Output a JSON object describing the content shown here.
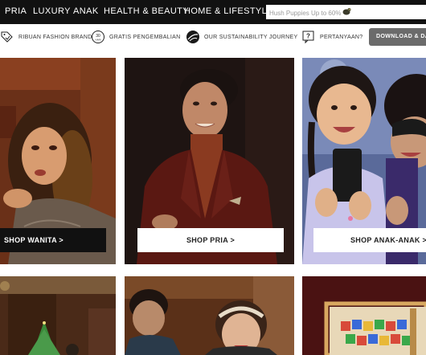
{
  "topnav": {
    "items": [
      "PRIA",
      "LUXURY",
      "ANAK",
      "HEALTH & BEAUTY",
      "HOME & LIFESTYLE"
    ],
    "search_placeholder": "Hush Puppies Up to 60%"
  },
  "benefits": [
    {
      "label": "RIBUAN FASHION BRAND",
      "icon": "tag-check-icon"
    },
    {
      "label": "GRATIS PENGEMBALIAN",
      "icon": "30-days-return-icon"
    },
    {
      "label": "OUR SUSTAINABILITY JOURNEY",
      "icon": "globe-leaf-icon"
    },
    {
      "label": "PERTANYAAN?",
      "icon": "question-chat-icon"
    }
  ],
  "download_label": "DOWNLOAD & DAPATKAN",
  "tiles": {
    "wanita": {
      "cta": "SHOP WANITA >"
    },
    "pria": {
      "cta": "SHOP PRIA >"
    },
    "anak": {
      "cta": "SHOP ANAK-ANAK >"
    }
  },
  "colors": {
    "nav_bg": "#111111",
    "button_bg": "#6b6b6b",
    "cta_dark": "#111111",
    "cta_light": "#ffffff"
  }
}
